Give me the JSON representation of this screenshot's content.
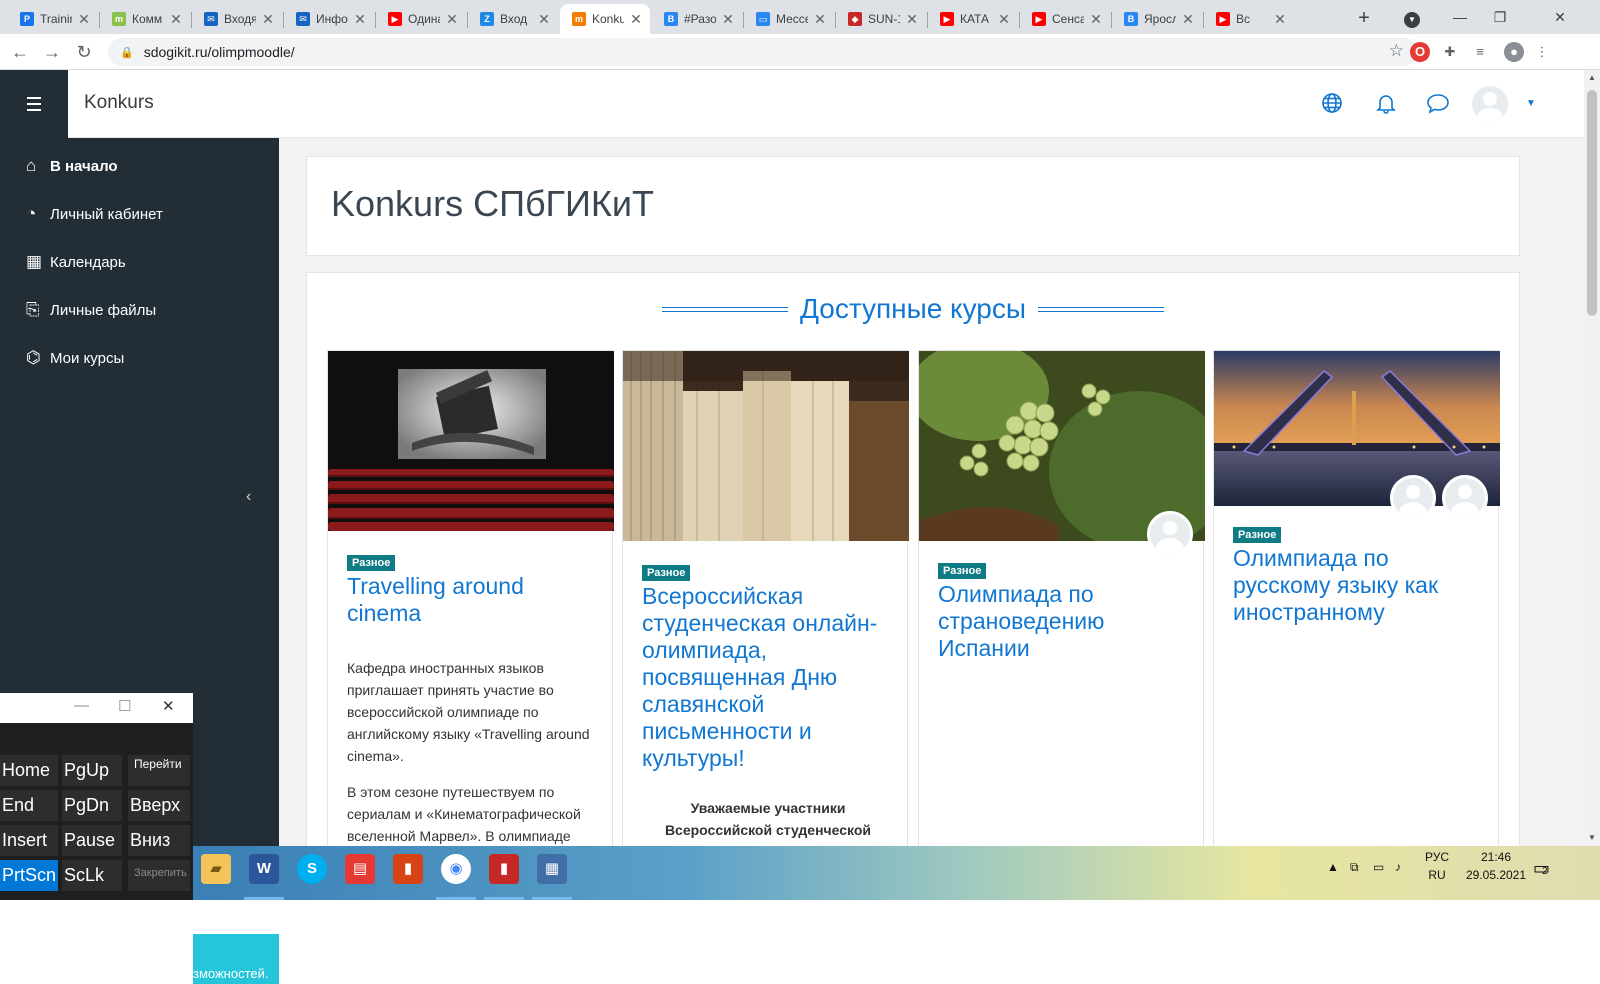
{
  "browser": {
    "tabs": [
      {
        "title": "Trainin",
        "icon": "pinterest-icon",
        "color": "#1a73e8"
      },
      {
        "title": "Комм",
        "icon": "m-icon",
        "color": "#8bc34a"
      },
      {
        "title": "Входя",
        "icon": "mail-icon",
        "color": "#1565c0"
      },
      {
        "title": "Инфо",
        "icon": "mail-icon",
        "color": "#1565c0"
      },
      {
        "title": "Одина",
        "icon": "youtube-icon",
        "color": "#ff0000"
      },
      {
        "title": "Вход",
        "icon": "z-icon",
        "color": "#1e88e5"
      },
      {
        "title": "Konku",
        "icon": "moodle-icon",
        "color": "#f57c00"
      },
      {
        "title": "#Разо",
        "icon": "vk-icon",
        "color": "#2787f5"
      },
      {
        "title": "Мессе",
        "icon": "chat-icon",
        "color": "#2787f5"
      },
      {
        "title": "SUN-1",
        "icon": "shield-icon",
        "color": "#c62828"
      },
      {
        "title": "КАТА",
        "icon": "youtube-icon",
        "color": "#ff0000"
      },
      {
        "title": "Сенса",
        "icon": "youtube-icon",
        "color": "#ff0000"
      },
      {
        "title": "Яросл",
        "icon": "vk-icon",
        "color": "#2787f5"
      },
      {
        "title": "Вс",
        "icon": "youtube-icon",
        "color": "#ff0000"
      }
    ],
    "url": "sdogikit.ru/olimpmoodle/"
  },
  "navbar": {
    "brand": "Konkurs"
  },
  "drawer": {
    "items": [
      {
        "label": "В начало",
        "icon": "home-icon"
      },
      {
        "label": "Личный кабинет",
        "icon": "dashboard-icon"
      },
      {
        "label": "Календарь",
        "icon": "calendar-icon"
      },
      {
        "label": "Личные файлы",
        "icon": "files-icon"
      },
      {
        "label": "Мои курсы",
        "icon": "graduation-cap-icon"
      }
    ],
    "cyan_text": "зможностей."
  },
  "main": {
    "page_title": "Konkurs СПбГИКиТ",
    "courses_heading": "Доступные курсы",
    "courses": [
      {
        "category": "Разное",
        "name": "Travelling around cinema",
        "desc_1": "Кафедра иностранных языков приглашает принять участие во всероссийской олимпиаде по английскому языку «Travelling around cinema».",
        "desc_2": "В этом сезоне путешествуем по сериалам и «Кинематографической вселенной Марвел». В олимпиаде"
      },
      {
        "category": "Разное",
        "name": "Всероссийская студенческая онлайн-олимпиада, посвященная Дню славянской письменности и культуры!",
        "desc_1": "Уважаемые участники Всероссийской студенческой"
      },
      {
        "category": "Разное",
        "name": "Олимпиада по страноведению Испании"
      },
      {
        "category": "Разное",
        "name": "Олимпиада по русскому языку как иностранному"
      }
    ]
  },
  "osk": {
    "rows": [
      [
        "Home",
        "PgUp",
        "Перейти"
      ],
      [
        "End",
        "PgDn",
        "Вверх"
      ],
      [
        "Insert",
        "Pause",
        "Вниз"
      ],
      [
        "PrtScn",
        "ScLk",
        "Закрепить"
      ]
    ]
  },
  "taskbar": {
    "lang_top": "РУС",
    "lang_bottom": "RU",
    "time": "21:46",
    "date": "29.05.2021",
    "notif_count": "2"
  }
}
